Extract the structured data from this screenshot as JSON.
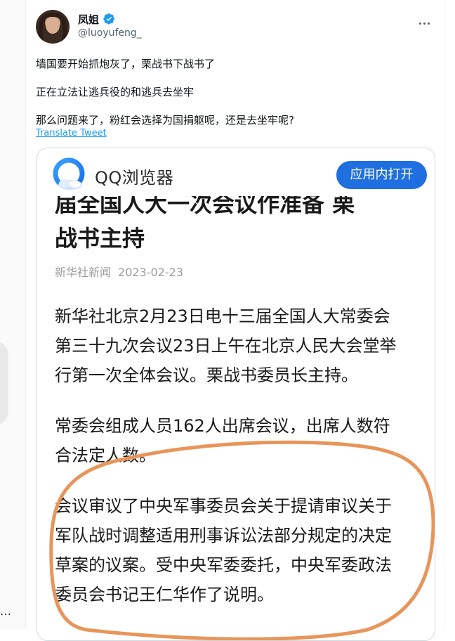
{
  "tweet": {
    "display_name": "凤姐",
    "handle": "@luoyufeng_",
    "text_lines": [
      "墙国要开始抓炮灰了，栗战书下战书了",
      "正在立法让逃兵役的和逃兵去坐牢",
      "那么问题来了，粉红会选择为国捐躯呢，还是去坐牢呢?"
    ],
    "translate_label": "Translate Tweet"
  },
  "media": {
    "browser_name": "QQ浏览器",
    "open_button_label": "应用内打开",
    "article": {
      "title_line1": "届全国人大一次会议作准备      栗",
      "title_line2": "战书主持",
      "source": "新华社新闻",
      "date": "2023-02-23",
      "paragraphs": [
        [
          "新华社北京2月23日电十三届全国人大常委会",
          "第三十九次会议23日上午在北京人民大会堂举",
          "行第一次全体会议。栗战书委员长主持。"
        ],
        [
          "常委会组成人员162人出席会议，出席人数符",
          "合法定人数。"
        ],
        [
          "会议审议了中央军事委员会关于提请审议关于",
          "军队战时调整适用刑事诉讼法部分规定的决定",
          "草案的议案。受中央军委委托，中央军委政法",
          "委员会书记王仁华作了说明。"
        ]
      ]
    }
  },
  "colors": {
    "accent": "#1d9bf0",
    "qq_button": "#1f6fe0",
    "annotation": "#e8955a"
  },
  "icons": [
    "verified-icon",
    "more-icon",
    "qq-browser-logo-icon"
  ]
}
